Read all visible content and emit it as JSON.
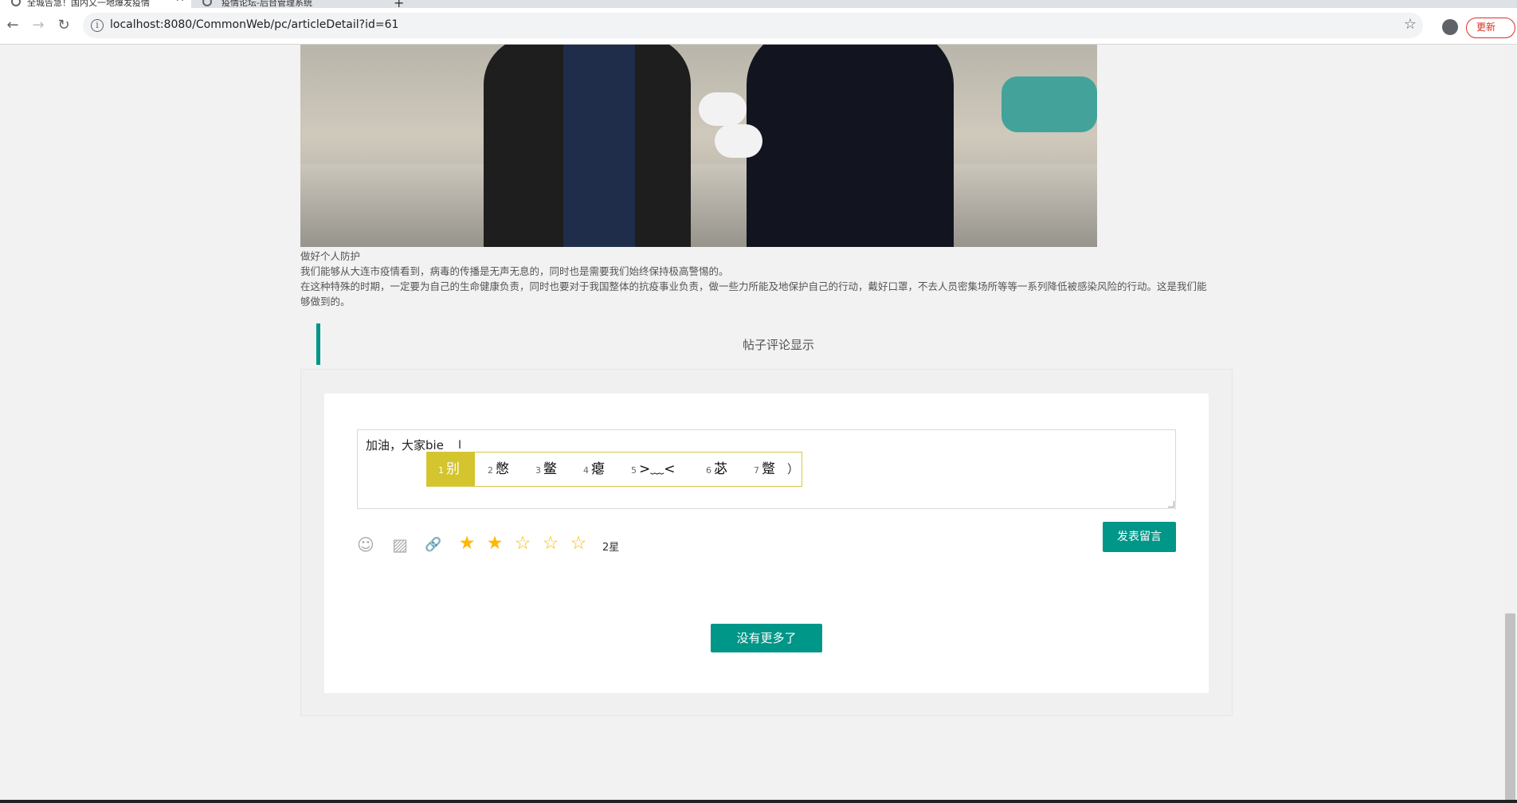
{
  "browser": {
    "tabs": [
      {
        "title": "全城告急！国内又一地爆发疫情"
      },
      {
        "title": "疫情论坛-后台管理系统"
      }
    ],
    "url": "localhost:8080/CommonWeb/pc/articleDetail?id=61",
    "update_label": "更新",
    "nav": {
      "back": "←",
      "forward": "→",
      "reload": "↻",
      "close": "✕",
      "new_tab": "+",
      "info": "i",
      "bookmark": "☆"
    }
  },
  "article": {
    "paragraphs": [
      "做好个人防护",
      "我们能够从大连市疫情看到，病毒的传播是无声无息的，同时也是需要我们始终保持极高警惕的。",
      "在这种特殊的时期，一定要为自己的生命健康负责，同时也要对于我国整体的抗疫事业负责，做一些力所能及地保护自己的行动，戴好口罩，不去人员密集场所等等一系列降低被感染风险的行动。这是我们能够做到的。"
    ]
  },
  "comments": {
    "section_title": "帖子评论显示",
    "input_text": "加油，大家bie",
    "ime_candidates": [
      {
        "num": "1",
        "text": "别"
      },
      {
        "num": "2",
        "text": "憋"
      },
      {
        "num": "3",
        "text": "鳖"
      },
      {
        "num": "4",
        "text": "瘪"
      },
      {
        "num": "5",
        "text": ">﹏<"
      },
      {
        "num": "6",
        "text": "苾"
      },
      {
        "num": "7",
        "text": "蹩"
      }
    ],
    "ime_more": "）",
    "tools": [
      {
        "icon": "emoji-icon",
        "glyph": "☺"
      },
      {
        "icon": "image-icon",
        "glyph": "▨"
      },
      {
        "icon": "link-icon",
        "glyph": "🔗"
      }
    ],
    "rating": {
      "value": 2,
      "max": 5,
      "label": "2星",
      "on_glyph": "★",
      "off_glyph": "☆"
    },
    "submit_label": "发表留言",
    "load_more_label": "没有更多了"
  }
}
